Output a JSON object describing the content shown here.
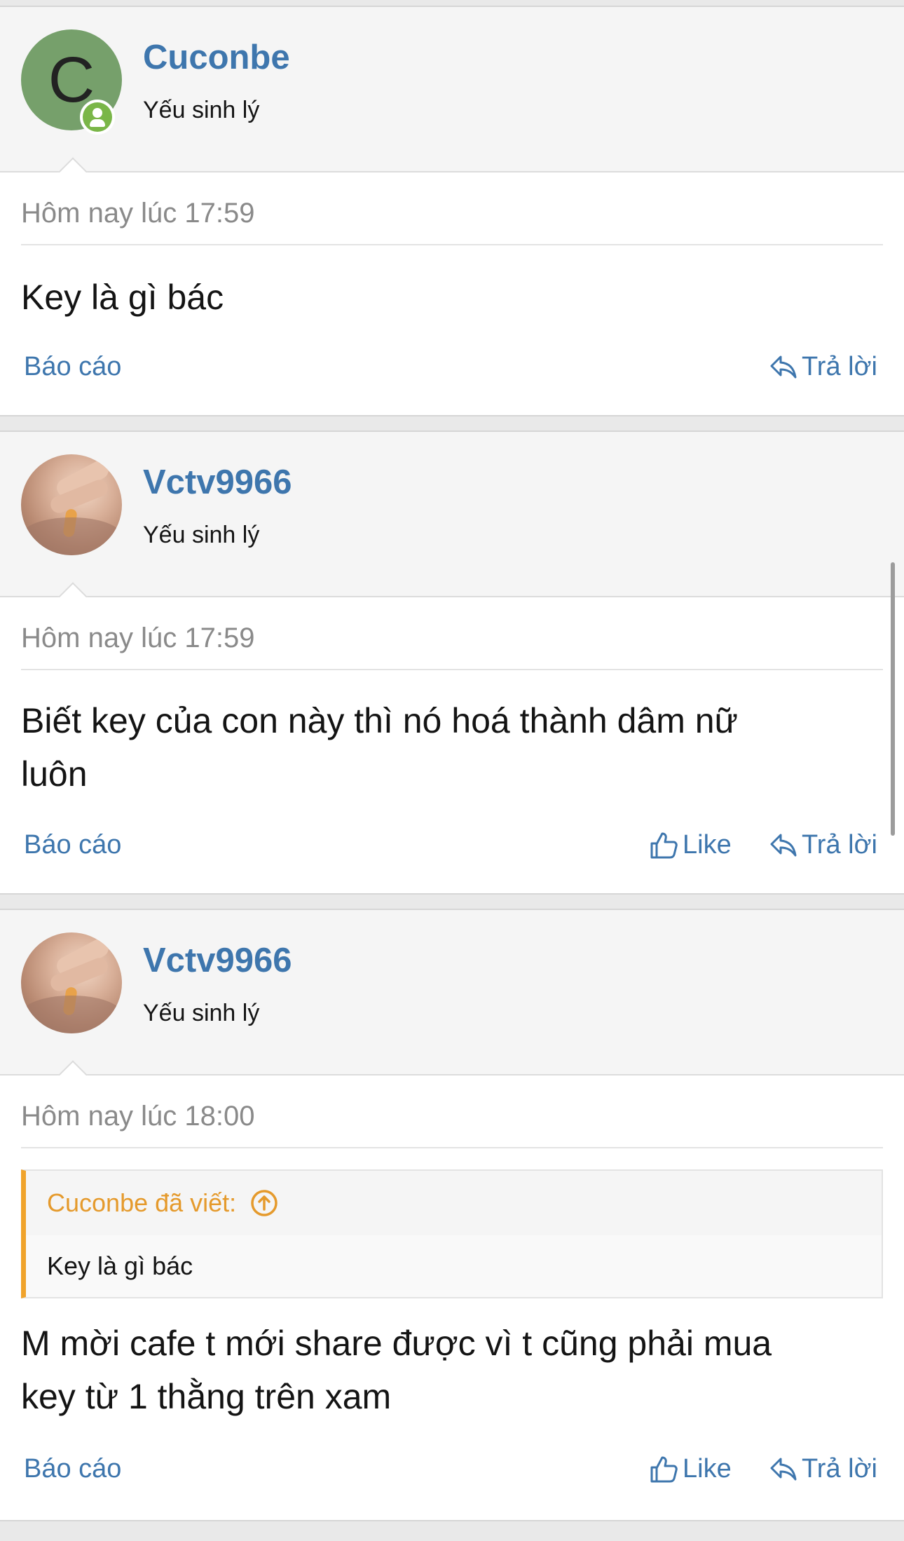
{
  "posts": [
    {
      "username": "Cuconbe",
      "avatar_letter": "C",
      "avatar_type": "letter",
      "online": true,
      "user_title": "Yếu sinh lý",
      "timestamp": "Hôm nay lúc 17:59",
      "message_lines": [
        "Key là gì bác"
      ],
      "actions": {
        "report": "Báo cáo",
        "like": null,
        "reply": "Trả lời"
      }
    },
    {
      "username": "Vctv9966",
      "avatar_type": "photo",
      "online": false,
      "user_title": "Yếu sinh lý",
      "timestamp": "Hôm nay lúc 17:59",
      "message_lines": [
        "Biết key của con này thì nó hoá thành dâm nữ",
        "luôn"
      ],
      "actions": {
        "report": "Báo cáo",
        "like": "Like",
        "reply": "Trả lời"
      }
    },
    {
      "username": "Vctv9966",
      "avatar_type": "photo",
      "online": false,
      "user_title": "Yếu sinh lý",
      "timestamp": "Hôm nay lúc 18:00",
      "quote": {
        "author_line": "Cuconbe đã viết:",
        "text": "Key là gì bác"
      },
      "message_lines": [
        "M mời cafe t mới share được vì t cũng phải mua",
        "key từ 1 thằng trên xam"
      ],
      "actions": {
        "report": "Báo cáo",
        "like": "Like",
        "reply": "Trả lời"
      }
    }
  ],
  "colors": {
    "link": "#3e76ad",
    "quote_accent": "#f0a32b",
    "online": "#7ab648"
  }
}
